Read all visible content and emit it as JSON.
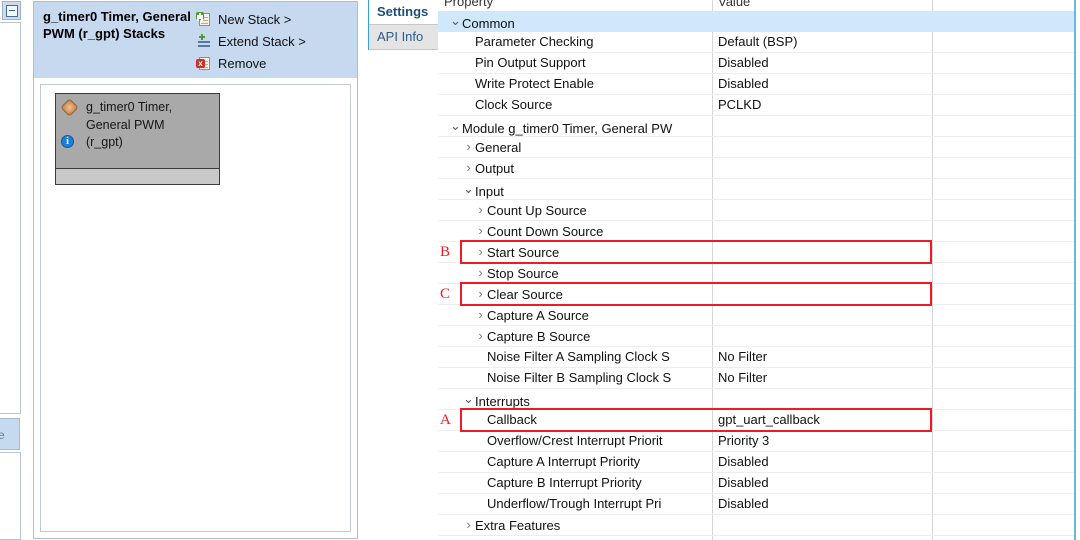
{
  "left_strip": {
    "collapse_icon": "minimize-icon",
    "edge_tab_label": "re"
  },
  "stacks_panel": {
    "title": "g_timer0 Timer, General PWM (r_gpt) Stacks",
    "actions": [
      {
        "icon": "new-stack-icon",
        "label": "New Stack >"
      },
      {
        "icon": "extend-stack-icon",
        "label": "Extend Stack >"
      },
      {
        "icon": "remove-icon",
        "label": "Remove"
      }
    ],
    "stack_box": {
      "icon": "module-icon",
      "line1": "g_timer0 Timer,",
      "line2": "General PWM",
      "line3": "(r_gpt)",
      "info_icon": "info-icon",
      "info_glyph": "i"
    }
  },
  "tabs": [
    {
      "label": "Settings",
      "selected": true
    },
    {
      "label": "API Info",
      "selected": false
    }
  ],
  "table": {
    "headers": {
      "property": "Property",
      "value": "Value"
    },
    "rows": [
      {
        "indent": 0,
        "twisty": "expanded",
        "property": "Common",
        "value": "",
        "selected": true
      },
      {
        "indent": 1,
        "twisty": "none",
        "property": "Parameter Checking",
        "value": "Default (BSP)"
      },
      {
        "indent": 1,
        "twisty": "none",
        "property": "Pin Output Support",
        "value": "Disabled"
      },
      {
        "indent": 1,
        "twisty": "none",
        "property": "Write Protect Enable",
        "value": "Disabled"
      },
      {
        "indent": 1,
        "twisty": "none",
        "property": "Clock Source",
        "value": "PCLKD"
      },
      {
        "indent": 0,
        "twisty": "expanded",
        "property": "Module g_timer0 Timer, General PW",
        "value": ""
      },
      {
        "indent": 1,
        "twisty": "collapsed",
        "property": "General",
        "value": ""
      },
      {
        "indent": 1,
        "twisty": "collapsed",
        "property": "Output",
        "value": ""
      },
      {
        "indent": 1,
        "twisty": "expanded",
        "property": "Input",
        "value": ""
      },
      {
        "indent": 2,
        "twisty": "collapsed",
        "property": "Count Up Source",
        "value": ""
      },
      {
        "indent": 2,
        "twisty": "collapsed",
        "property": "Count Down Source",
        "value": ""
      },
      {
        "indent": 2,
        "twisty": "collapsed",
        "property": "Start Source",
        "value": "",
        "annotation": "B"
      },
      {
        "indent": 2,
        "twisty": "collapsed",
        "property": "Stop Source",
        "value": ""
      },
      {
        "indent": 2,
        "twisty": "collapsed",
        "property": "Clear Source",
        "value": "",
        "annotation": "C"
      },
      {
        "indent": 2,
        "twisty": "collapsed",
        "property": "Capture A Source",
        "value": ""
      },
      {
        "indent": 2,
        "twisty": "collapsed",
        "property": "Capture B Source",
        "value": ""
      },
      {
        "indent": 2,
        "twisty": "none",
        "property": "Noise Filter A Sampling Clock S",
        "value": "No Filter"
      },
      {
        "indent": 2,
        "twisty": "none",
        "property": "Noise Filter B Sampling Clock S",
        "value": "No Filter"
      },
      {
        "indent": 1,
        "twisty": "expanded",
        "property": "Interrupts",
        "value": ""
      },
      {
        "indent": 2,
        "twisty": "none",
        "property": "Callback",
        "value": "gpt_uart_callback",
        "annotation": "A"
      },
      {
        "indent": 2,
        "twisty": "none",
        "property": "Overflow/Crest Interrupt Priorit",
        "value": "Priority 3"
      },
      {
        "indent": 2,
        "twisty": "none",
        "property": "Capture A Interrupt Priority",
        "value": "Disabled"
      },
      {
        "indent": 2,
        "twisty": "none",
        "property": "Capture B Interrupt Priority",
        "value": "Disabled"
      },
      {
        "indent": 2,
        "twisty": "none",
        "property": "Underflow/Trough Interrupt Pri",
        "value": "Disabled"
      },
      {
        "indent": 1,
        "twisty": "collapsed",
        "property": "Extra Features",
        "value": ""
      }
    ]
  },
  "annotations": [
    {
      "letter": "A",
      "target_row": 19
    },
    {
      "letter": "B",
      "target_row": 11
    },
    {
      "letter": "C",
      "target_row": 13
    }
  ],
  "colors": {
    "header_blue": "#c6d9ef",
    "selected_row": "#cfe8fb",
    "annotation_red": "#ee1c22",
    "stack_box_gray": "#a9a9a9",
    "tab_text": "#2b5d8c"
  }
}
